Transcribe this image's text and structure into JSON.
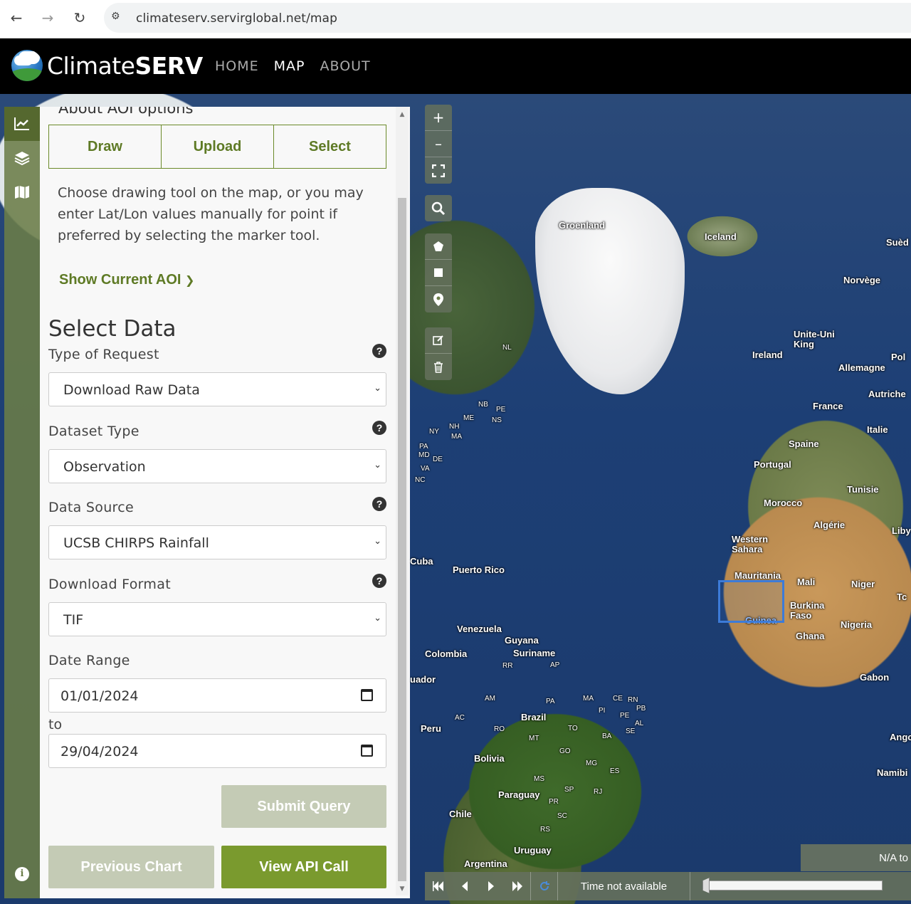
{
  "browser": {
    "url": "climateserv.servirglobal.net/map",
    "back_icon": "←",
    "forward_icon": "→",
    "reload_icon": "↻",
    "site_info_icon": "⚙"
  },
  "app": {
    "brand_light": "Climate",
    "brand_bold": "SERV",
    "nav": [
      "HOME",
      "MAP",
      "ABOUT"
    ],
    "active_nav": "MAP"
  },
  "panel": {
    "cut_heading": "About AOI options",
    "tabs": [
      "Draw",
      "Upload",
      "Select"
    ],
    "help_text": "Choose drawing tool on the map, or you may enter Lat/Lon values manually for point if preferred by selecting the marker tool.",
    "show_aoi": "Show Current AOI",
    "section_title": "Select Data",
    "fields": {
      "type_of_request": {
        "label": "Type of Request",
        "value": "Download Raw Data"
      },
      "dataset_type": {
        "label": "Dataset Type",
        "value": "Observation"
      },
      "data_source": {
        "label": "Data Source",
        "value": "UCSB CHIRPS Rainfall"
      },
      "download_format": {
        "label": "Download Format",
        "value": "TIF"
      }
    },
    "date_range": {
      "label": "Date Range",
      "start": "01/01/2024",
      "to": "to",
      "end": "29/04/2024"
    },
    "buttons": {
      "submit": "Submit Query",
      "previous_chart": "Previous Chart",
      "view_api": "View API Call"
    }
  },
  "map": {
    "labels": {
      "groenland": "Groenland",
      "iceland": "Iceland",
      "suede": "Suèd",
      "norvege": "Norvège",
      "uk": "Unite-Uni King",
      "ireland": "Ireland",
      "pologne": "Pol",
      "allemagne": "Allemagne",
      "autriche": "Autriche",
      "france": "France",
      "italie": "Italie",
      "spaine": "Spaine",
      "portugal": "Portugal",
      "tunisie": "Tunisie",
      "morocco": "Morocco",
      "algerie": "Algérie",
      "libya": "Liby",
      "western_sahara": "Western Sahara",
      "mauritania": "Mauritania",
      "mali": "Mali",
      "niger": "Niger",
      "tchad": "Tc",
      "burkina": "Burkina Faso",
      "guinea": "Guinea",
      "ghana": "Ghana",
      "nigeria": "Nigeria",
      "gabon": "Gabon",
      "angola": "Ango",
      "namibia": "Namibi",
      "puerto_rico": "Puerto Rico",
      "cuba": "Cuba",
      "venezuela": "Venezuela",
      "guyana": "Guyana",
      "suriname": "Suriname",
      "colombia": "Colombia",
      "ecuador": "uador",
      "peru": "Peru",
      "brazil": "Brazil",
      "bolivia": "Bolivia",
      "paraguay": "Paraguay",
      "chile": "Chile",
      "uruguay": "Uruguay",
      "argentina": "Argentina",
      "nl": "NL",
      "nb": "NB",
      "pe": "PE",
      "ns": "NS",
      "me": "ME",
      "nh": "NH",
      "ma_us": "MA",
      "ny": "NY",
      "pa": "PA",
      "md": "MD",
      "de": "DE",
      "va": "VA",
      "nc": "NC",
      "rr": "RR",
      "ap": "AP",
      "am": "AM",
      "pa_br": "PA",
      "ma_br": "MA",
      "ce": "CE",
      "rn": "RN",
      "pb": "PB",
      "pi": "PI",
      "pe_br": "PE",
      "al": "AL",
      "ac": "AC",
      "ro": "RO",
      "to": "TO",
      "se": "SE",
      "ba": "BA",
      "mt": "MT",
      "go": "GO",
      "mg": "MG",
      "es": "ES",
      "ms": "MS",
      "sp": "SP",
      "rj": "RJ",
      "pr": "PR",
      "sc": "SC",
      "rs": "RS"
    },
    "controls": {
      "zoom_in": "+",
      "zoom_out": "–"
    },
    "timeline": {
      "status": "Time not available",
      "na": "N/A to"
    }
  },
  "icons": {
    "chart": "chart-line-icon",
    "layers": "layers-icon",
    "map": "map-icon",
    "info": "info-icon"
  },
  "colors": {
    "accent": "#7a9a2e",
    "accent_text": "#5e7a25",
    "sidebar": "#6b7d48",
    "disabled": "#c4cbb5"
  }
}
